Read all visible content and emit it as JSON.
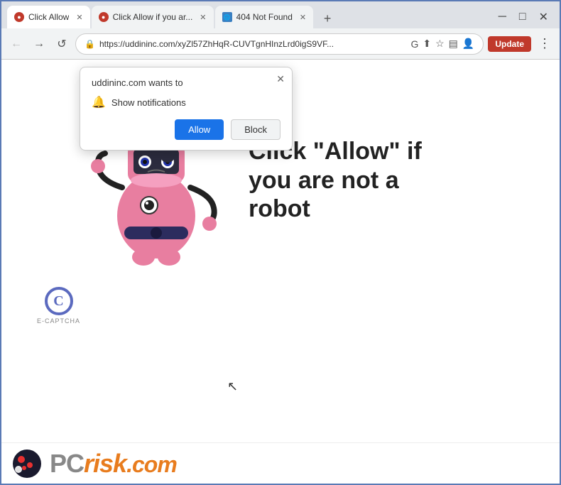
{
  "browser": {
    "tabs": [
      {
        "id": "tab1",
        "title": "Click Allow",
        "active": true,
        "favicon_color": "#c0392b"
      },
      {
        "id": "tab2",
        "title": "Click Allow if you ar...",
        "active": false,
        "favicon_color": "#c0392b"
      },
      {
        "id": "tab3",
        "title": "404 Not Found",
        "active": false,
        "favicon_color": "#3a7fc1"
      }
    ],
    "url": "https://uddininc.com/xyZl57ZhHqR-CUVTgnHInzLrd0igS9VF...",
    "update_label": "Update",
    "window_controls": [
      "⌄",
      "□",
      "✕"
    ]
  },
  "nav": {
    "back": "←",
    "forward": "→",
    "reload": "↺"
  },
  "notification_popup": {
    "site": "uddininc.com wants to",
    "close_label": "✕",
    "notification_label": "Show notifications",
    "allow_label": "Allow",
    "block_label": "Block"
  },
  "page": {
    "click_allow_text": "Click \"Allow\" if you are not a robot",
    "ecaptcha_label": "E-CAPTCHA"
  },
  "pcrisk": {
    "pc_text": "PC",
    "risk_text": "risk",
    "com_text": ".com"
  }
}
